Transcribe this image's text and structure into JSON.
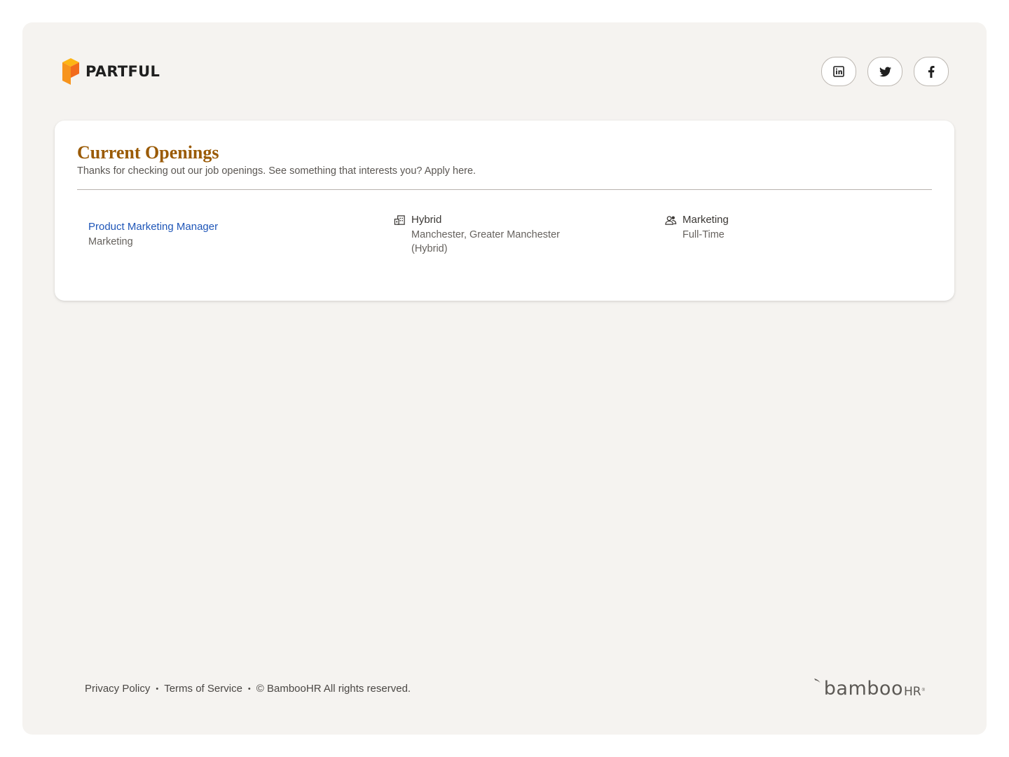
{
  "brand": {
    "name": "PARTFUL",
    "logo_colors": [
      "#f7941d",
      "#f26b1d",
      "#fdb515"
    ]
  },
  "header": {
    "social_links": [
      {
        "name": "linkedin",
        "icon": "linkedin-icon"
      },
      {
        "name": "twitter",
        "icon": "twitter-icon"
      },
      {
        "name": "facebook",
        "icon": "facebook-icon"
      }
    ]
  },
  "openings": {
    "title": "Current Openings",
    "subtitle": "Thanks for checking out our job openings. See something that interests you? Apply here.",
    "jobs": [
      {
        "title": "Product Marketing Manager",
        "department": "Marketing",
        "location_type": "Hybrid",
        "location_line1": "Manchester, Greater Manchester",
        "location_line2": "(Hybrid)",
        "team": "Marketing",
        "employment_type": "Full-Time",
        "location_icon": "building-icon",
        "team_icon": "people-icon"
      }
    ]
  },
  "footer": {
    "privacy": "Privacy Policy",
    "separator": "•",
    "terms": "Terms of Service",
    "copyright": "© BambooHR All rights reserved.",
    "powered_by": {
      "word": "bamboo",
      "suffix": "HR",
      "trademark": "®"
    }
  },
  "colors": {
    "page_bg": "#f5f3f0",
    "title": "#9a5a04",
    "link": "#1f56b8"
  }
}
